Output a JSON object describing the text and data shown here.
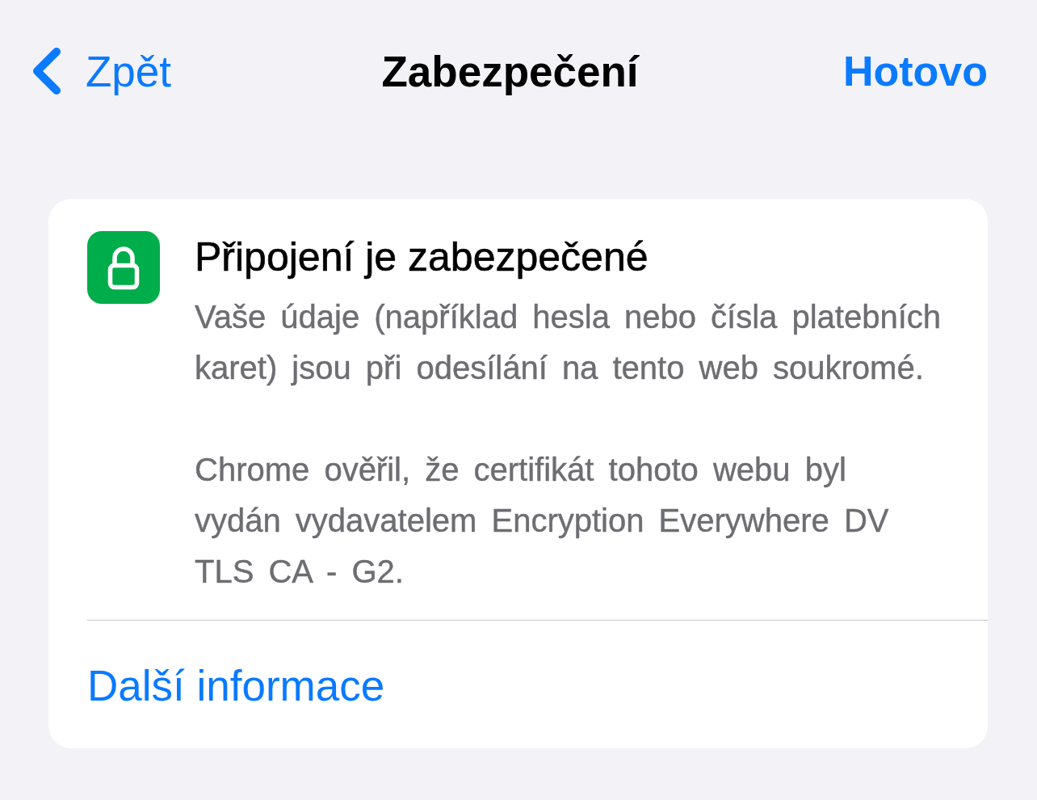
{
  "nav": {
    "back": "Zpět",
    "title": "Zabezpečení",
    "done": "Hotovo"
  },
  "card": {
    "title": "Připojení je zabezpečené",
    "paragraphs": [
      "Vaše údaje (například hesla nebo čísla platebních karet) jsou při odesílání na tento web soukromé.",
      "Chrome ověřil, že certifikát tohoto webu byl vydán vydavatelem Encryption Everywhere DV TLS CA - G2."
    ],
    "link": "Další informace"
  }
}
